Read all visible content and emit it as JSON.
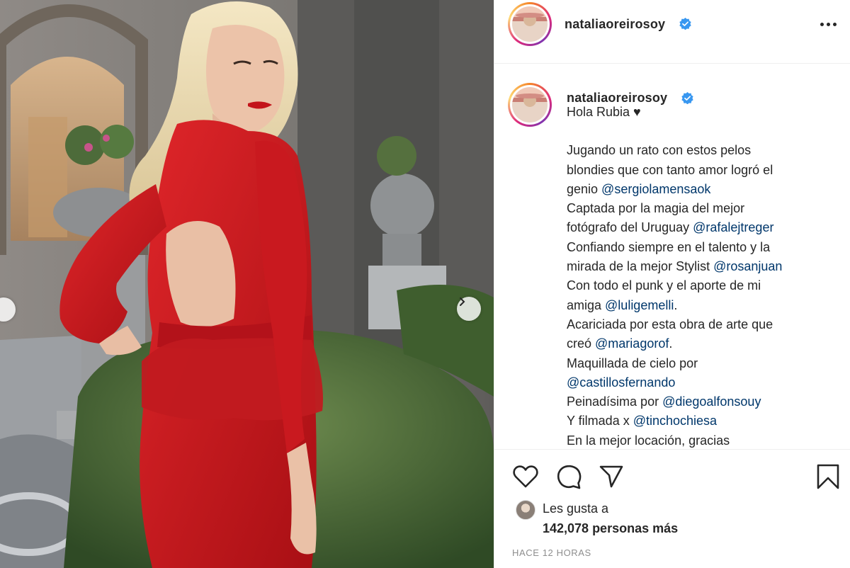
{
  "post": {
    "username": "nataliaoreirosoy",
    "verified": true,
    "more_icon": "more-horizontal-icon"
  },
  "caption": {
    "first_line": "Hola Rubia ♥",
    "lines": [
      {
        "parts": [
          {
            "text": "Jugando un rato con estos pelos"
          }
        ]
      },
      {
        "parts": [
          {
            "text": "blondies que con tanto amor logró el"
          }
        ]
      },
      {
        "parts": [
          {
            "text": "genio "
          },
          {
            "text": "@sergiolamensaok",
            "mention": true
          }
        ]
      },
      {
        "parts": [
          {
            "text": "Captada por la magia del mejor"
          }
        ]
      },
      {
        "parts": [
          {
            "text": "fotógrafo del Uruguay "
          },
          {
            "text": "@rafalejtreger",
            "mention": true
          }
        ]
      },
      {
        "parts": [
          {
            "text": "Confiando siempre en el talento y la"
          }
        ]
      },
      {
        "parts": [
          {
            "text": "mirada de la mejor Stylist "
          },
          {
            "text": "@rosanjuan",
            "mention": true
          }
        ]
      },
      {
        "parts": [
          {
            "text": "Con todo el punk y el aporte de mi"
          }
        ]
      },
      {
        "parts": [
          {
            "text": "amiga "
          },
          {
            "text": "@luligemelli",
            "mention": true
          },
          {
            "text": "."
          }
        ]
      },
      {
        "parts": [
          {
            "text": "Acariciada por esta obra de arte que"
          }
        ]
      },
      {
        "parts": [
          {
            "text": "creó "
          },
          {
            "text": "@mariagorof",
            "mention": true
          },
          {
            "text": "."
          }
        ]
      },
      {
        "parts": [
          {
            "text": "Maquillada de cielo por"
          }
        ]
      },
      {
        "parts": [
          {
            "text": "@castillosfernando",
            "mention": true
          }
        ]
      },
      {
        "parts": [
          {
            "text": "Peinadísima por "
          },
          {
            "text": "@diegoalfonsouy",
            "mention": true
          }
        ]
      },
      {
        "parts": [
          {
            "text": "Y filmada x "
          },
          {
            "text": "@tinchochiesa",
            "mention": true
          }
        ]
      },
      {
        "parts": [
          {
            "text": "En la mejor locación, gracias"
          }
        ]
      }
    ]
  },
  "actions": {
    "like_icon": "heart-icon",
    "comment_icon": "comment-icon",
    "share_icon": "send-icon",
    "save_icon": "bookmark-icon"
  },
  "likes": {
    "line1": "Les gusta a",
    "line2": "142,078 personas más"
  },
  "timestamp": "HACE 12 HORAS",
  "carousel": {
    "prev_icon": "chevron-left-icon",
    "next_icon": "chevron-right-icon"
  },
  "colors": {
    "mention": "#00376b",
    "verified": "#3897f0",
    "dress": "#c8171b"
  }
}
